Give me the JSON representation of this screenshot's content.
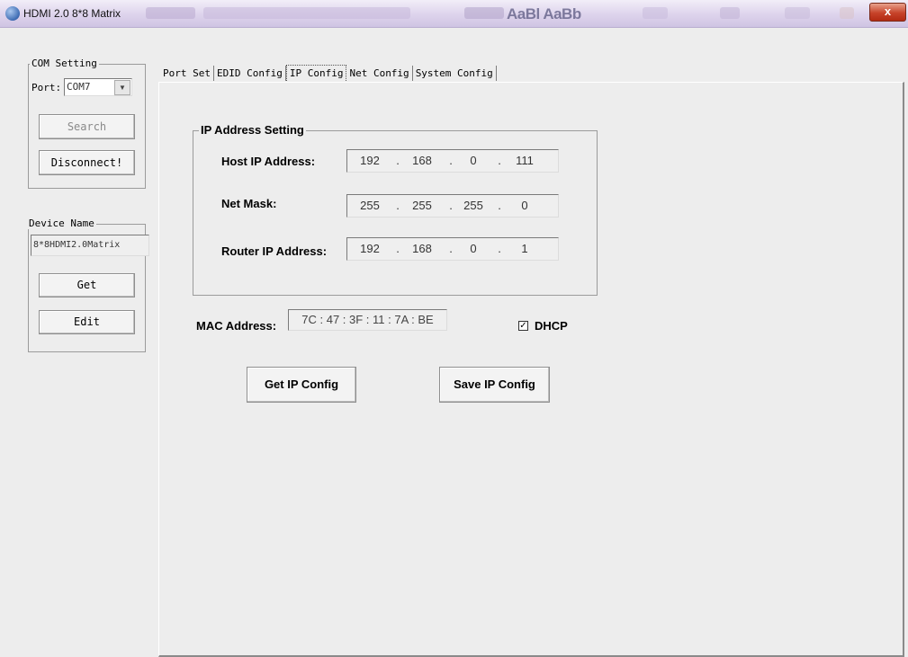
{
  "window": {
    "title": "HDMI 2.0 8*8 Matrix",
    "background_text": "AaBl AaBb",
    "close_glyph": "x"
  },
  "com_setting": {
    "group_label": "COM Setting",
    "port_label": "Port:",
    "port_value": "COM7",
    "search_label": "Search",
    "disconnect_label": "Disconnect!"
  },
  "device_name": {
    "group_label": "Device Name",
    "value": "8*8HDMI2.0Matrix",
    "get_label": "Get",
    "edit_label": "Edit"
  },
  "tabs": [
    {
      "label": "Port Set",
      "selected": false
    },
    {
      "label": "EDID Config",
      "selected": false
    },
    {
      "label": "IP Config",
      "selected": true
    },
    {
      "label": "Net Config",
      "selected": false
    },
    {
      "label": "System Config",
      "selected": false
    }
  ],
  "ip_config": {
    "group_label": "IP Address Setting",
    "host_label": "Host IP Address:",
    "host_ip": [
      "192",
      "168",
      "0",
      "111"
    ],
    "mask_label": "Net Mask:",
    "net_mask": [
      "255",
      "255",
      "255",
      "0"
    ],
    "router_label": "Router IP Address:",
    "router_ip": [
      "192",
      "168",
      "0",
      "1"
    ],
    "dot": ".",
    "mac_label": "MAC Address:",
    "mac_value": "7C : 47 : 3F : 11 : 7A : BE",
    "dhcp_label": "DHCP",
    "dhcp_checked": true,
    "check_glyph": "✓",
    "get_button": "Get IP Config",
    "save_button": "Save IP Config"
  }
}
